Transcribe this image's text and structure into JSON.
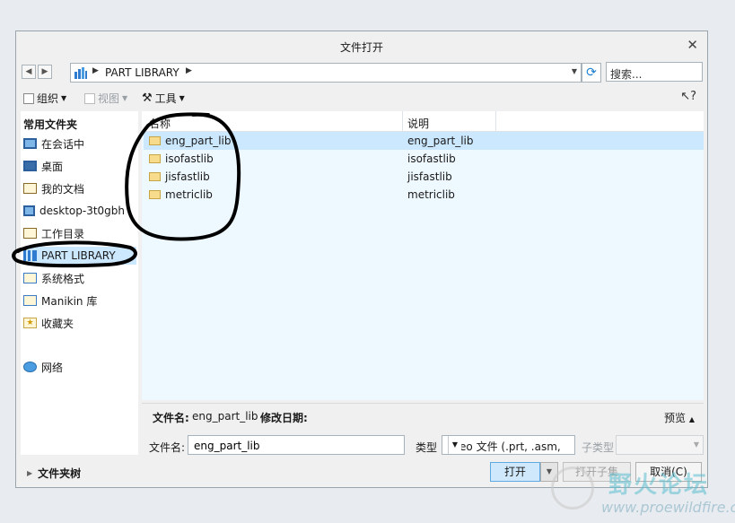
{
  "window": {
    "title": "文件打开"
  },
  "nav": {
    "path": "PART LIBRARY",
    "search_placeholder": "搜索..."
  },
  "toolbar": {
    "organize": "组织",
    "view": "视图",
    "tools": "工具"
  },
  "sidebar": {
    "header": "常用文件夹",
    "items": [
      {
        "label": "在会话中",
        "icon": "monitor-icon"
      },
      {
        "label": "桌面",
        "icon": "desktop-icon"
      },
      {
        "label": "我的文档",
        "icon": "documents-icon"
      },
      {
        "label": "desktop-3t0gbh",
        "icon": "computer-icon"
      },
      {
        "label": "工作目录",
        "icon": "working-dir-icon"
      },
      {
        "label": "PART LIBRARY",
        "icon": "library-icon",
        "selected": true
      },
      {
        "label": "系统格式",
        "icon": "system-format-icon"
      },
      {
        "label": "Manikin 库",
        "icon": "manikin-icon"
      },
      {
        "label": "收藏夹",
        "icon": "favorites-icon"
      },
      {
        "label": "网络",
        "icon": "network-icon"
      }
    ]
  },
  "filelist": {
    "columns": [
      "名称",
      "说明"
    ],
    "rows": [
      {
        "name": "eng_part_lib",
        "desc": "eng_part_lib",
        "selected": true
      },
      {
        "name": "isofastlib",
        "desc": "isofastlib"
      },
      {
        "name": "jisfastlib",
        "desc": "jisfastlib"
      },
      {
        "name": "metriclib",
        "desc": "metriclib"
      }
    ]
  },
  "details": {
    "filename_label": "文件名:",
    "filename_value": "eng_part_lib",
    "modified_label": "修改日期:",
    "preview_label": "预览"
  },
  "footer": {
    "filename_label": "文件名:",
    "filename_value": "eng_part_lib",
    "type_label": "类型",
    "type_value": "Creo 文件 (.prt, .asm,",
    "subtype_label": "子类型",
    "folder_tree_label": "文件夹树",
    "open_label": "打开",
    "open_sub_label": "打开子集",
    "cancel_label": "取消(C)"
  },
  "watermark": {
    "text": "野火论坛",
    "url": "www.proewildfire.cn"
  },
  "colors": {
    "selection": "#cce8ff",
    "annotation": "#000000"
  }
}
